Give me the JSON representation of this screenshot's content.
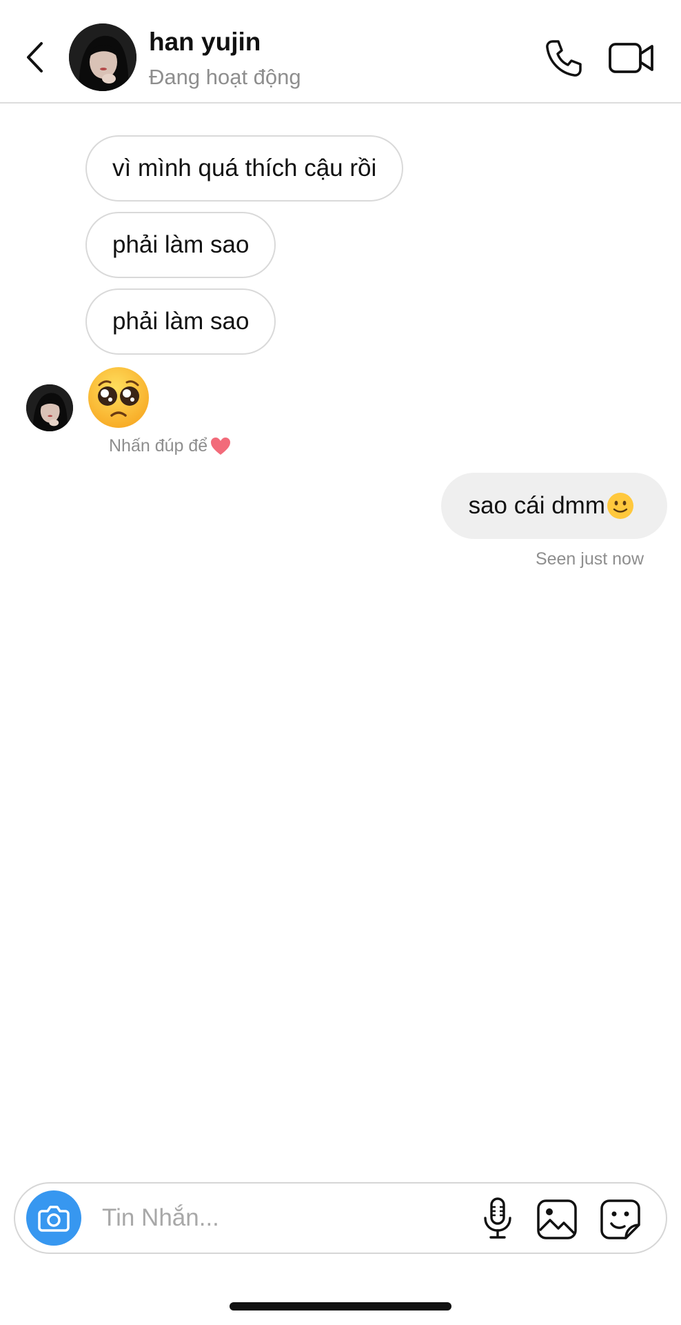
{
  "header": {
    "contact_name": "han yujin",
    "status": "Đang hoạt động"
  },
  "messages": {
    "incoming": [
      "vì mình quá thích cậu rồi",
      "phải làm sao",
      "phải làm sao"
    ],
    "incoming_emoji": "pleading-face",
    "double_tap_hint": "Nhấn đúp để",
    "outgoing": "sao cái dmm",
    "outgoing_emoji": "slightly-smiling-face",
    "seen_status": "Seen just now"
  },
  "composer": {
    "placeholder": "Tin Nhắn..."
  },
  "colors": {
    "accent_blue": "#3797f0",
    "outgoing_bubble": "#efefef",
    "border_gray": "#d9d9d9",
    "secondary_text": "#8e8e8e",
    "heart": "#f26b7a",
    "emoji_yellow": "#ffc83d"
  }
}
